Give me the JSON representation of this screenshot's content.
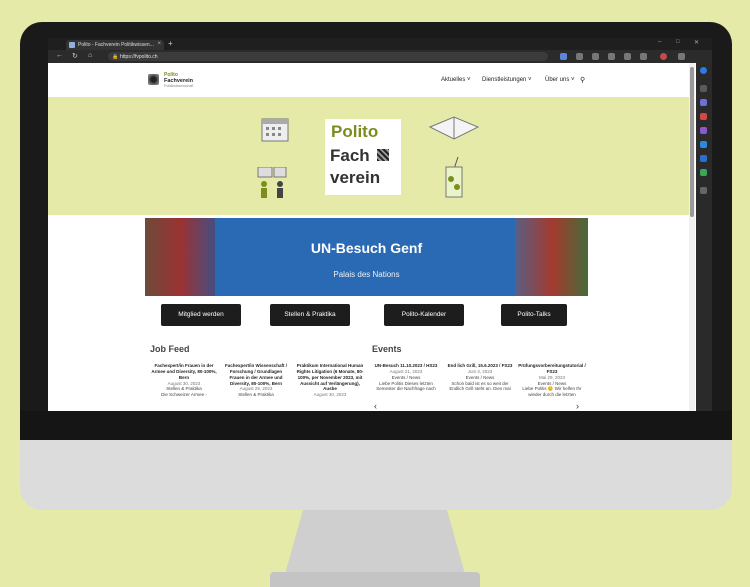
{
  "browser": {
    "tab_title": "Polito - Fachverein Politikwissen...",
    "url": "https://fvpolito.ch",
    "new_tab_symbol": "+",
    "window_controls": [
      "–",
      "□",
      "✕"
    ]
  },
  "site": {
    "logo": {
      "line1": "Polito",
      "line2": "Fachverein",
      "line3": "Politikwissenschaft"
    },
    "nav": [
      {
        "label": "Aktuelles ˅"
      },
      {
        "label": "Dienstleistungen ˅"
      },
      {
        "label": "Über uns ˅"
      }
    ],
    "hero": {
      "word1": "Polito",
      "word2": "Fach",
      "word3": "verein"
    },
    "banner": {
      "title": "UN-Besuch Genf",
      "subtitle": "Palais des Nations"
    },
    "cta_buttons": [
      {
        "label": "Mitglied werden"
      },
      {
        "label": "Stellen & Praktika"
      },
      {
        "label": "Polito-Kalender"
      },
      {
        "label": "Polito-Talks"
      }
    ],
    "job_feed": {
      "title": "Job Feed",
      "items": [
        {
          "title": "Fachexpert/in Frauen in der Armee und Diversity, 80-100%, Bern",
          "date": "August 30, 2023",
          "category": "Stellen & Praktika",
          "excerpt": "Die Schweizer Armee -"
        },
        {
          "title": "Fachexpert/in Wissenschaft / Forschung / Grundlagen Frauen in der Armee und Diversity, 80-100%, Bern",
          "date": "August 29, 2023",
          "category": "Stellen & Praktika",
          "excerpt": ""
        },
        {
          "title": "Praktikum International Human Rights Litigation (6 Monate, 80-100%, per November 2023, mit Aussicht auf Verlängerung), Ausbe",
          "date": "August 30, 2023",
          "category": "",
          "excerpt": ""
        }
      ]
    },
    "events": {
      "title": "Events",
      "items": [
        {
          "title": "UN-Besuch 11.10.2023 / HS23",
          "date": "August 21, 2023",
          "category": "Events / News",
          "excerpt": "Liebe Politis Dieses letzten Semester die Nachfrage nach"
        },
        {
          "title": "End lich Grill, 15.6.2023 / FS23",
          "date": "Juni 3, 2023",
          "category": "Events / News",
          "excerpt": "Schon bald ist es so weit der Endlich Grill steht an. Dies mal"
        },
        {
          "title": "Prüfungsvorbereitungstutorial / FS23",
          "date": "Mai 29, 2023",
          "category": "Events / News",
          "excerpt": "Liebe Politis 😊 Wir helfen Ihr wieder durch die letzten"
        }
      ]
    }
  },
  "colors": {
    "accent": "#7a8d1e",
    "hero_bg": "#e6eaa8",
    "button_bg": "#1d1d1d",
    "banner_blue": "#2a69b3"
  }
}
